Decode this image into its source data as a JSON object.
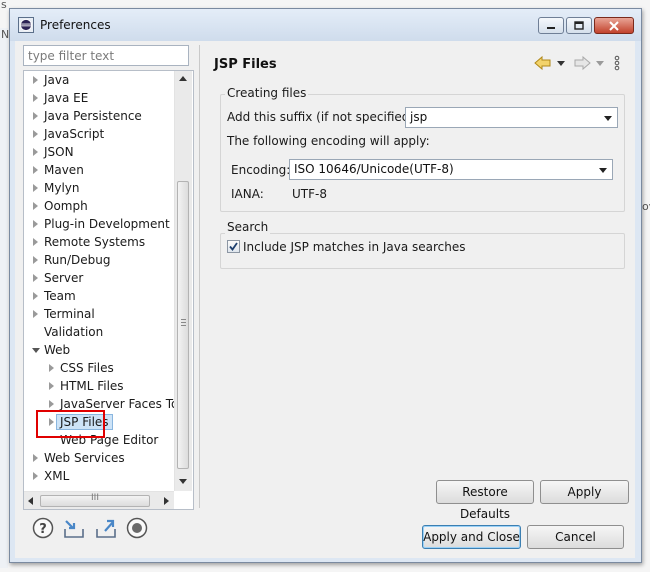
{
  "window": {
    "title": "Preferences",
    "controls": [
      "minimize",
      "maximize",
      "close"
    ]
  },
  "filter": {
    "placeholder": "type filter text",
    "value": ""
  },
  "tree": {
    "items": [
      {
        "label": "Java",
        "level": 0,
        "expander": "collapsed"
      },
      {
        "label": "Java EE",
        "level": 0,
        "expander": "collapsed"
      },
      {
        "label": "Java Persistence",
        "level": 0,
        "expander": "collapsed"
      },
      {
        "label": "JavaScript",
        "level": 0,
        "expander": "collapsed"
      },
      {
        "label": "JSON",
        "level": 0,
        "expander": "collapsed"
      },
      {
        "label": "Maven",
        "level": 0,
        "expander": "collapsed"
      },
      {
        "label": "Mylyn",
        "level": 0,
        "expander": "collapsed"
      },
      {
        "label": "Oomph",
        "level": 0,
        "expander": "collapsed"
      },
      {
        "label": "Plug-in Development",
        "level": 0,
        "expander": "collapsed"
      },
      {
        "label": "Remote Systems",
        "level": 0,
        "expander": "collapsed"
      },
      {
        "label": "Run/Debug",
        "level": 0,
        "expander": "collapsed"
      },
      {
        "label": "Server",
        "level": 0,
        "expander": "collapsed"
      },
      {
        "label": "Team",
        "level": 0,
        "expander": "collapsed"
      },
      {
        "label": "Terminal",
        "level": 0,
        "expander": "collapsed"
      },
      {
        "label": "Validation",
        "level": 0,
        "expander": "none"
      },
      {
        "label": "Web",
        "level": 0,
        "expander": "expanded"
      },
      {
        "label": "CSS Files",
        "level": 1,
        "expander": "collapsed"
      },
      {
        "label": "HTML Files",
        "level": 1,
        "expander": "collapsed"
      },
      {
        "label": "JavaServer Faces Too",
        "level": 1,
        "expander": "collapsed"
      },
      {
        "label": "JSP Files",
        "level": 1,
        "expander": "collapsed",
        "selected": true
      },
      {
        "label": "Web Page Editor",
        "level": 1,
        "expander": "none"
      },
      {
        "label": "Web Services",
        "level": 0,
        "expander": "collapsed"
      },
      {
        "label": "XML",
        "level": 0,
        "expander": "collapsed"
      }
    ],
    "hscroll_glyph": "III"
  },
  "page": {
    "title": "JSP Files",
    "creating_files": {
      "group_label": "Creating files",
      "suffix_label": "Add this suffix (if not specified):",
      "suffix_value": "jsp",
      "encoding_info": "The following encoding will apply:",
      "encoding_label": "Encoding:",
      "encoding_value": "ISO 10646/Unicode(UTF-8)",
      "iana_label": "IANA:",
      "iana_value": "UTF-8"
    },
    "search": {
      "group_label": "Search",
      "include_label": "Include JSP matches in Java searches",
      "include_checked": true
    },
    "restore_defaults": "Restore Defaults",
    "apply": "Apply"
  },
  "footer": {
    "apply_and_close": "Apply and Close",
    "cancel": "Cancel",
    "icons": [
      "help-icon",
      "import-icon",
      "export-icon",
      "record-icon"
    ]
  },
  "colors": {
    "selection_bg": "#cde3f7",
    "highlight_box": "#e00000",
    "nav_back": "#e0b020"
  }
}
